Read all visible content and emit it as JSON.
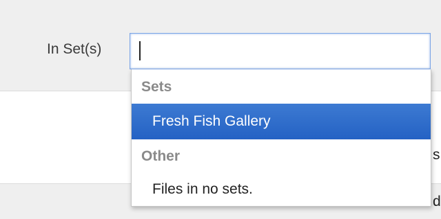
{
  "form": {
    "label": "In Set(s)",
    "input_value": ""
  },
  "dropdown": {
    "groups": [
      {
        "header": "Sets",
        "options": [
          "Fresh Fish Gallery"
        ]
      },
      {
        "header": "Other",
        "options": [
          "Files in no sets."
        ]
      }
    ],
    "highlighted_option": "Fresh Fish Gallery"
  },
  "background_peek": [
    "s",
    "d"
  ],
  "colors": {
    "page_band": "#efefef",
    "input_focus_border": "#7aa4e6",
    "highlight": "#2d6fcd",
    "group_header_text": "#8a8a8a"
  }
}
